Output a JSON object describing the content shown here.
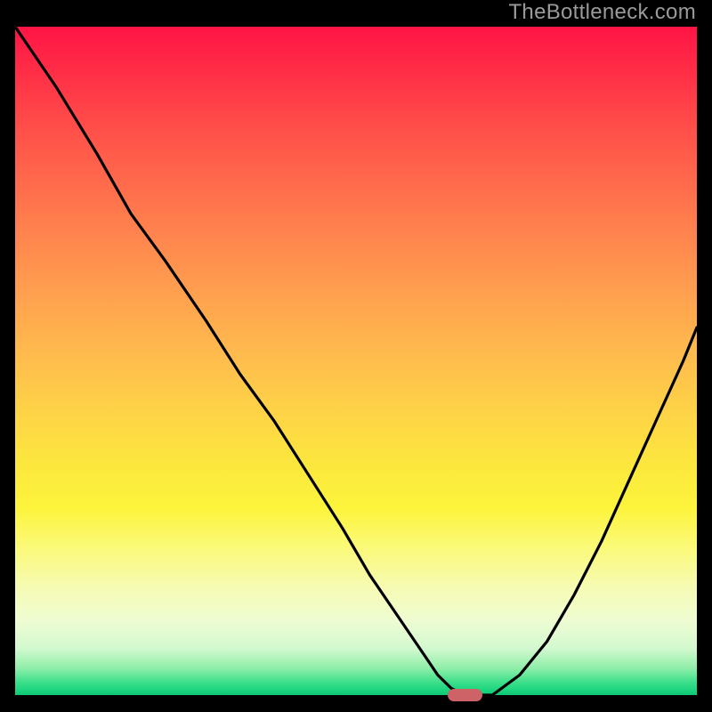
{
  "watermark": "TheBottleneck.com",
  "colors": {
    "frame_bg": "#000000",
    "curve_stroke": "#000000",
    "marker_fill": "#cd6267",
    "watermark_text": "#9a9a9a"
  },
  "chart_data": {
    "type": "line",
    "title": "",
    "xlabel": "",
    "ylabel": "",
    "xlim": [
      0,
      100
    ],
    "ylim": [
      0,
      100
    ],
    "annotations": [
      "TheBottleneck.com"
    ],
    "series": [
      {
        "name": "bottleneck-curve",
        "x": [
          0,
          6,
          12,
          17,
          22,
          28,
          33,
          38,
          43,
          48,
          52,
          56,
          60,
          62,
          64,
          66,
          70,
          74,
          78,
          82,
          86,
          90,
          94,
          98,
          100
        ],
        "y": [
          100,
          91,
          81,
          72,
          65,
          56,
          48,
          41,
          33,
          25,
          18,
          12,
          6,
          3,
          1,
          0,
          0,
          3,
          8,
          15,
          23,
          32,
          41,
          50,
          55
        ]
      }
    ],
    "marker": {
      "x": 66,
      "y": 0,
      "width_pct": 5.2,
      "height_pct": 1.9
    },
    "background_gradient": {
      "orientation": "vertical",
      "stops": [
        {
          "pct": 0,
          "color": "#ff1445"
        },
        {
          "pct": 15,
          "color": "#ff4e49"
        },
        {
          "pct": 38,
          "color": "#ff9a4f"
        },
        {
          "pct": 58,
          "color": "#fed446"
        },
        {
          "pct": 72,
          "color": "#fdf43c"
        },
        {
          "pct": 89,
          "color": "#eefcd2"
        },
        {
          "pct": 98,
          "color": "#3fe08c"
        },
        {
          "pct": 100,
          "color": "#0fc673"
        }
      ]
    }
  }
}
